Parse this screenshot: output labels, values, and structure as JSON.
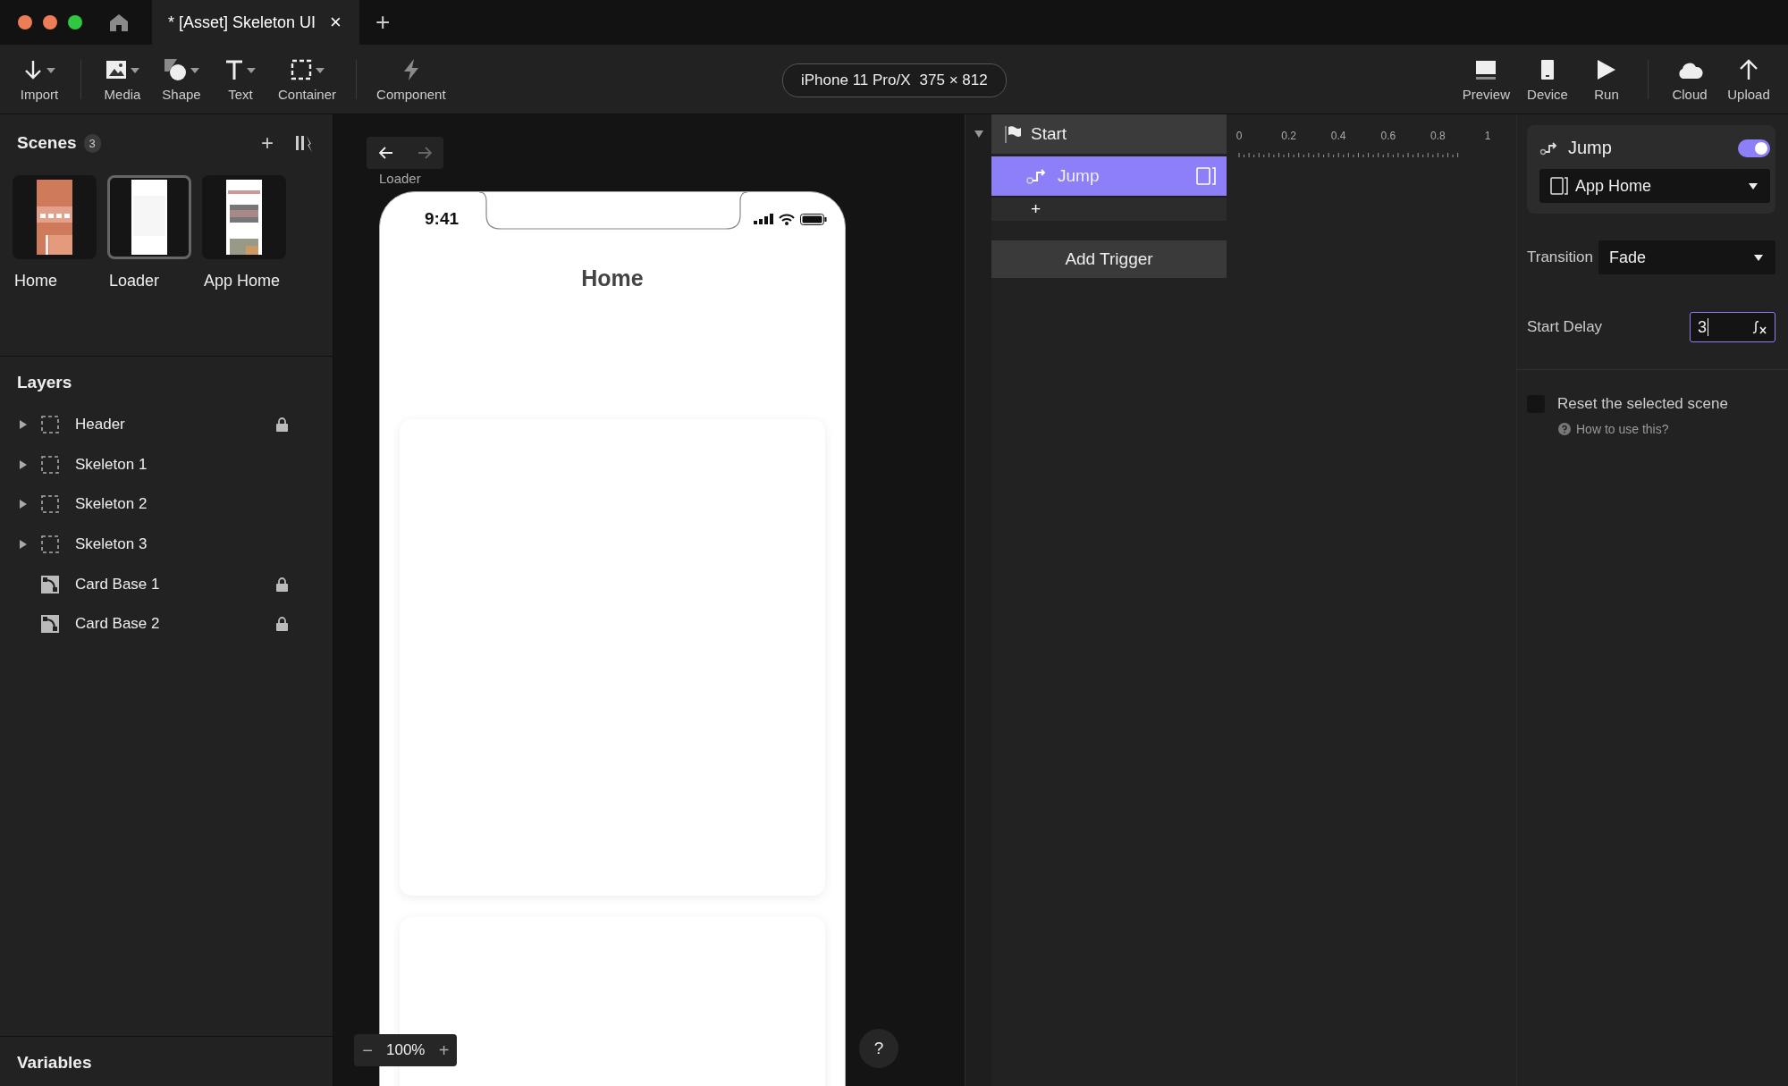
{
  "title_bar": {
    "tab": {
      "title": "* [Asset] Skeleton UI",
      "close": "×",
      "selected": true
    },
    "new_tab": "+"
  },
  "toolbar": {
    "left": [
      {
        "label": "Import",
        "dropdown": true
      },
      {
        "label": "Media",
        "dropdown": true
      },
      {
        "label": "Shape",
        "dropdown": true
      },
      {
        "label": "Text",
        "dropdown": true
      },
      {
        "label": "Container",
        "dropdown": true
      },
      {
        "label": "Component",
        "dropdown": false
      }
    ],
    "device": {
      "name": "iPhone 11 Pro/X",
      "size": "375 × 812"
    },
    "right": [
      {
        "label": "Preview"
      },
      {
        "label": "Device"
      },
      {
        "label": "Run"
      },
      {
        "label": "Cloud"
      },
      {
        "label": "Upload"
      }
    ]
  },
  "scenes": {
    "title": "Scenes",
    "count": "3",
    "add": "+",
    "items": [
      {
        "name": "Home",
        "selected": false
      },
      {
        "name": "Loader",
        "selected": true
      },
      {
        "name": "App Home",
        "selected": false
      }
    ]
  },
  "layers": {
    "title": "Layers",
    "items": [
      {
        "name": "Header",
        "kind": "container",
        "expanded": false,
        "locked": true
      },
      {
        "name": "Skeleton 1",
        "kind": "container",
        "expanded": false,
        "locked": false
      },
      {
        "name": "Skeleton 2",
        "kind": "container",
        "expanded": false,
        "locked": false
      },
      {
        "name": "Skeleton 3",
        "kind": "container",
        "expanded": false,
        "locked": false
      },
      {
        "name": "Card Base 1",
        "kind": "shape",
        "locked": true
      },
      {
        "name": "Card Base 2",
        "kind": "shape",
        "locked": true
      }
    ]
  },
  "variables": {
    "title": "Variables"
  },
  "canvas": {
    "back_disabled": false,
    "forward_disabled": true,
    "scene_label": "Loader",
    "phone": {
      "time": "9:41",
      "title": "Home"
    },
    "zoom": {
      "minus": "−",
      "value": "100%",
      "plus": "+"
    },
    "help": "?"
  },
  "triggers": {
    "start": {
      "label": "Start",
      "expanded": true
    },
    "actions": [
      {
        "label": "Jump",
        "selected": true
      }
    ],
    "add_action": "+",
    "add_trigger": "Add Trigger"
  },
  "timeline": {
    "ticks": [
      "0",
      "0.2",
      "0.4",
      "0.6",
      "0.8",
      "1"
    ]
  },
  "inspector": {
    "action": {
      "title": "Jump",
      "enabled": true,
      "target": "App Home"
    },
    "transition": {
      "label": "Transition",
      "value": "Fade"
    },
    "start_delay": {
      "label": "Start Delay",
      "value": "3"
    },
    "reset": {
      "label": "Reset the selected scene",
      "checked": false
    },
    "help": "How to use this?"
  }
}
